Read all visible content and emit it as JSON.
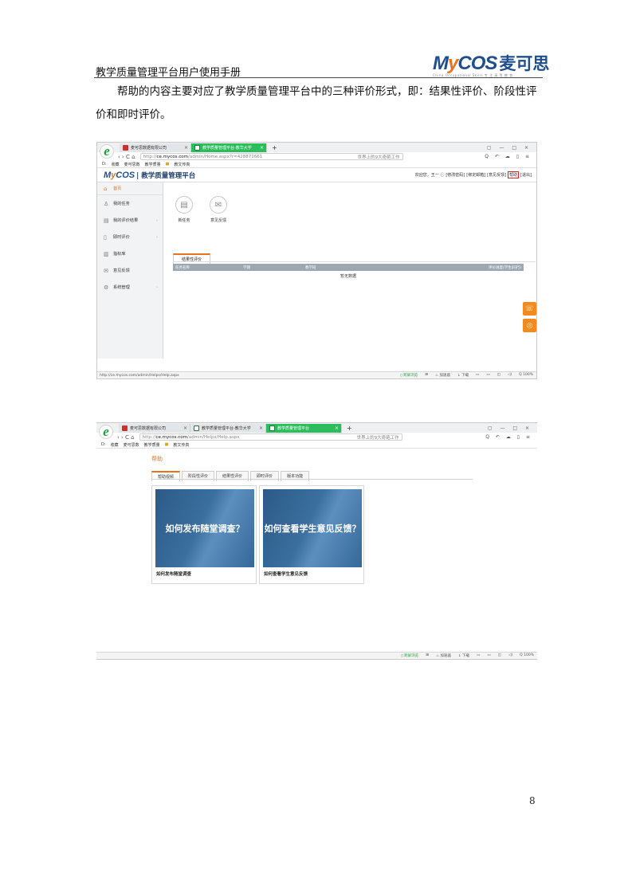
{
  "header": {
    "doc_title": "教学质量管理平台用户使用手册",
    "logo_en_m": "M",
    "logo_en_y": "y",
    "logo_en_rest": "COS",
    "logo_cn": "麦可思",
    "logo_sub": "China Occupational Skills  专 注 高 等 教 育"
  },
  "paragraph_1": "帮助的内容主要对应了教学质量管理平台中的三种评价形式，即：结果性评价、阶段性评价和即时评价。",
  "screenshot_1": {
    "tabs": [
      {
        "label": "麦可思数据有限公司",
        "close": "×"
      },
      {
        "label": "教学质量管理平台-教华大学",
        "close": "×"
      }
    ],
    "tab_plus": "+",
    "window_controls": "▢ — □ ×",
    "nav": "‹ › C ⌂",
    "url_prefix": "http://",
    "url_host": "ce.mycos.com",
    "url_path": "/admin/Home.aspx?r=428871661",
    "search_hint": "世界上的9大奇葩工作",
    "right_tools": "Q ↶ ☁ ▯ ≡",
    "bookmarks": [
      "D:",
      "收藏",
      "麦可思数",
      "教学质量",
      "教文传真"
    ],
    "app_logo_y": "y",
    "app_logo_rest": "COS",
    "app_logo_m": "M",
    "app_title": "| 教学质量管理平台",
    "user_links": [
      "欢迎您，王一 ⓘ",
      "[修改密码]",
      "[绑定邮箱]",
      "[意见反馈]",
      "帮助",
      "[退出]"
    ],
    "sidebar": [
      {
        "icon": "⌂",
        "label": "首页"
      },
      {
        "icon": "♙",
        "label": "我的任务"
      },
      {
        "icon": "▤",
        "label": "我的评价结果",
        "arrow": "›"
      },
      {
        "icon": "▯",
        "label": "即时评价",
        "arrow": "›"
      },
      {
        "icon": "▥",
        "label": "指标库"
      },
      {
        "icon": "✉",
        "label": "意见反馈"
      },
      {
        "icon": "⚙",
        "label": "系统管理",
        "arrow": "›"
      }
    ],
    "quick_actions": [
      {
        "icon": "▤",
        "label": "新任务"
      },
      {
        "icon": "✉",
        "label": "意见反馈"
      }
    ],
    "result_tab": "结果性评价",
    "table_headers": [
      "任务名称",
      "学期",
      "教学班",
      "评价进度(学生|同行)"
    ],
    "empty_text": "暂无数据",
    "float_phone": "☏",
    "float_chat": "◎",
    "status_url": "http://ce.mycos.com/admin/Helps/Help.aspx",
    "status_items": [
      "▯ 跨屏浏览",
      "⊞",
      "♨ 加速器",
      "↓ 下载",
      "▭",
      "▭",
      "◫",
      "◁)",
      "Q 100%"
    ]
  },
  "screenshot_2": {
    "tabs": [
      {
        "label": "麦可思数据有限公司",
        "close": "×"
      },
      {
        "label": "教学质量管理平台-教华大学",
        "close": "×"
      },
      {
        "label": "教学质量管理平台",
        "close": "×"
      }
    ],
    "tab_plus": "+",
    "window_controls": "▢ — □ ×",
    "nav": "‹ › C ⌂",
    "url_prefix": "http://",
    "url_host": "ce.mycos.com",
    "url_path": "/admin/Helps/Help.aspx",
    "search_hint": "世界上的9大奇葩工作",
    "right_tools": "Q ↶ ☁ ▯ ≡",
    "bookmarks": [
      "D:",
      "收藏",
      "麦可思数",
      "教学质量",
      "教文传真"
    ],
    "help_title": "帮助",
    "help_tabs": [
      "帮助视频",
      "阶段性评价",
      "结果性评价",
      "即时评价",
      "版本功能"
    ],
    "cards": [
      {
        "thumb_text": "如何发布随堂调查？",
        "caption": "如何发布随堂调查"
      },
      {
        "thumb_text": "如何查看学生意见反馈？",
        "caption": "如何查看学生意见反馈"
      }
    ],
    "status_items": [
      "▯ 跨屏浏览",
      "⊞",
      "♨ 加速器",
      "↓ 下载",
      "▭",
      "▭",
      "◫",
      "◁)",
      "Q 100%"
    ]
  },
  "page_number": "8"
}
